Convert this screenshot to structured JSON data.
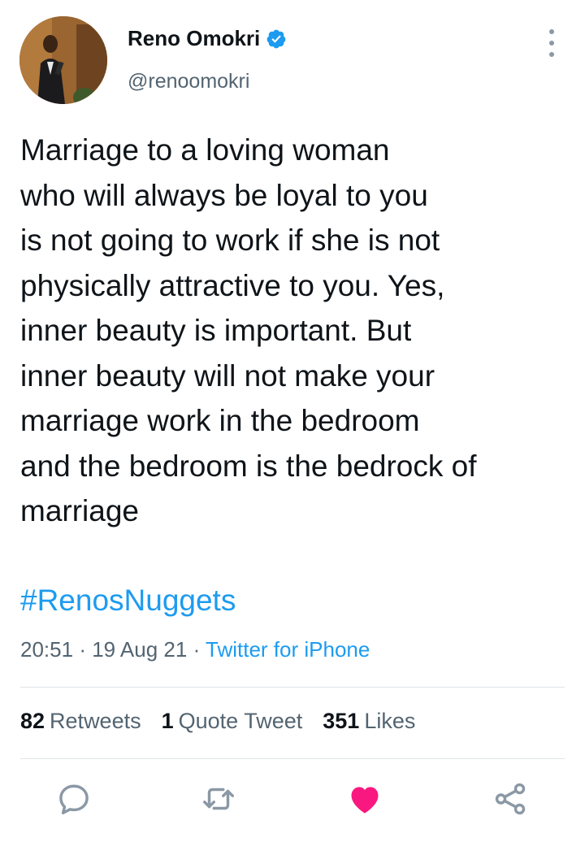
{
  "author": {
    "display_name": "Reno Omokri",
    "handle": "@renoomokri",
    "verified_icon": "verified-badge-icon",
    "avatar_icon": "profile-photo"
  },
  "tweet": {
    "lines": [
      "Marriage to a loving woman",
      "who will always be loyal to you",
      "is not going to work if she is not",
      "physically attractive to you. Yes,",
      "inner beauty is important. But",
      "inner beauty will not make your",
      "marriage work in the bedroom",
      "and the bedroom is the bedrock of",
      "marriage"
    ],
    "hashtag": "#RenosNuggets",
    "time": "20:51",
    "separator": "·",
    "date": "19 Aug 21",
    "source": "Twitter for iPhone"
  },
  "stats": {
    "retweets_count": "82",
    "retweets_label": "Retweets",
    "quotes_count": "1",
    "quotes_label": "Quote Tweet",
    "likes_count": "351",
    "likes_label": "Likes"
  },
  "actions": {
    "reply_icon": "reply-icon",
    "retweet_icon": "retweet-icon",
    "like_icon": "heart-icon",
    "share_icon": "share-icon"
  },
  "colors": {
    "accent": "#1d9bf0",
    "like": "#f91880",
    "text": "#0f1419",
    "secondary": "#536471",
    "icon": "#8b98a5"
  }
}
